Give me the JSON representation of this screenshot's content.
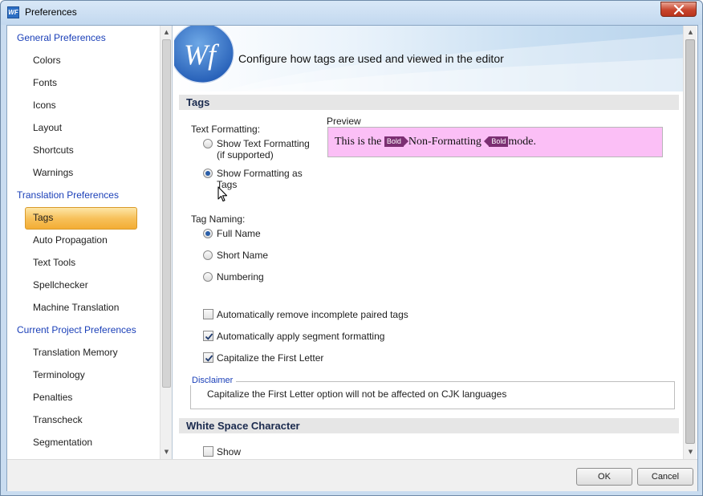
{
  "window": {
    "title": "Preferences",
    "app_icon_text": "WF"
  },
  "sidebar": {
    "items": [
      {
        "label": "General Preferences",
        "kind": "group"
      },
      {
        "label": "Colors",
        "kind": "item"
      },
      {
        "label": "Fonts",
        "kind": "item"
      },
      {
        "label": "Icons",
        "kind": "item"
      },
      {
        "label": "Layout",
        "kind": "item"
      },
      {
        "label": "Shortcuts",
        "kind": "item"
      },
      {
        "label": "Warnings",
        "kind": "item"
      },
      {
        "label": "Translation Preferences",
        "kind": "group"
      },
      {
        "label": "Tags",
        "kind": "item",
        "selected": true
      },
      {
        "label": "Auto Propagation",
        "kind": "item"
      },
      {
        "label": "Text Tools",
        "kind": "item"
      },
      {
        "label": "Spellchecker",
        "kind": "item"
      },
      {
        "label": "Machine Translation",
        "kind": "item"
      },
      {
        "label": "Current Project Preferences",
        "kind": "group"
      },
      {
        "label": "Translation Memory",
        "kind": "item"
      },
      {
        "label": "Terminology",
        "kind": "item"
      },
      {
        "label": "Penalties",
        "kind": "item"
      },
      {
        "label": "Transcheck",
        "kind": "item"
      },
      {
        "label": "Segmentation",
        "kind": "item"
      }
    ]
  },
  "banner": {
    "logo_text": "Wf",
    "heading": "Configure how tags are used and viewed in the editor"
  },
  "tags_section": {
    "header": "Tags",
    "text_formatting_label": "Text Formatting:",
    "text_formatting_options": [
      {
        "line1": "Show Text Formatting",
        "line2": "(if supported)",
        "selected": false
      },
      {
        "line1": "Show Formatting as",
        "line2": "Tags",
        "selected": true
      }
    ],
    "preview": {
      "label": "Preview",
      "text_before": "This is the ",
      "tag_open": "Bold",
      "text_middle": "Non-Formatting ",
      "tag_close": "Bold",
      "text_after": "mode."
    },
    "tag_naming_label": "Tag Naming:",
    "tag_naming_options": [
      {
        "label": "Full Name",
        "selected": true
      },
      {
        "label": "Short Name",
        "selected": false
      },
      {
        "label": "Numbering",
        "selected": false
      }
    ],
    "checkboxes": [
      {
        "label": "Automatically remove incomplete paired tags",
        "checked": false
      },
      {
        "label": "Automatically apply segment formatting",
        "checked": true
      },
      {
        "label": "Capitalize the First Letter",
        "checked": true
      }
    ],
    "disclaimer": {
      "legend": "Disclaimer",
      "text": "Capitalize the First Letter option will not be affected on CJK languages"
    }
  },
  "white_space_section": {
    "header": "White Space Character",
    "show_label": "Show",
    "show_checked": false
  },
  "footer": {
    "ok_label": "OK",
    "cancel_label": "Cancel"
  },
  "colors": {
    "selected_item": "#f7c15b",
    "group_text": "#1a3fb8",
    "preview_bg": "#fbbff6",
    "tag_bg": "#7b2f72",
    "close_button": "#c8452d"
  }
}
